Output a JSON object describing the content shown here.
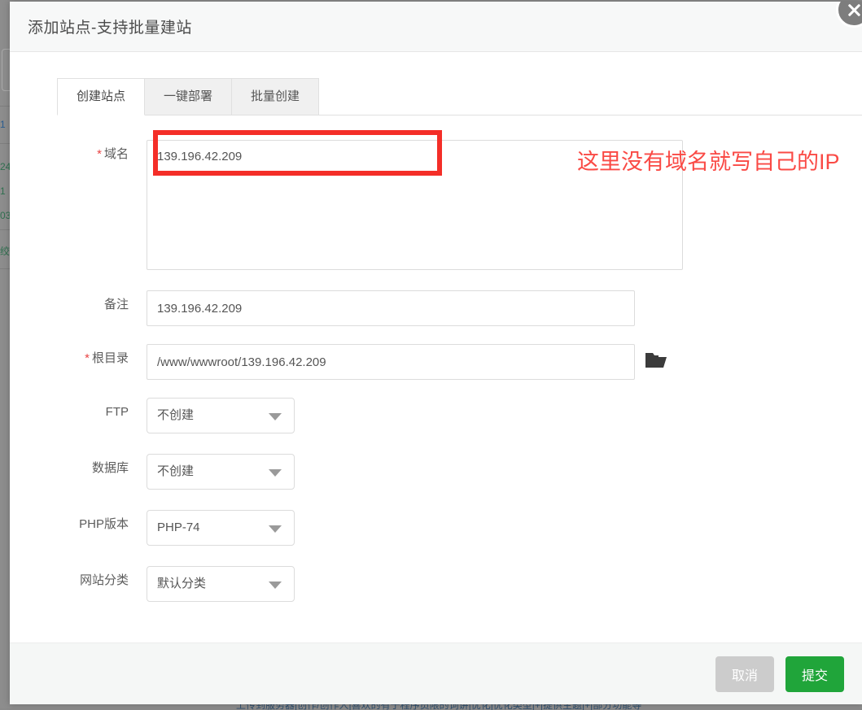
{
  "window": {
    "title": "添加站点-支持批量建站",
    "close_icon": "close-circle-icon"
  },
  "tabs": [
    {
      "label": "创建站点",
      "active": true
    },
    {
      "label": "一键部署",
      "active": false
    },
    {
      "label": "批量创建",
      "active": false
    }
  ],
  "form": {
    "domain": {
      "label": "域名",
      "required_mark": "*",
      "value": "139.196.42.209",
      "placeholder": ""
    },
    "remark": {
      "label": "备注",
      "value": "139.196.42.209",
      "placeholder": ""
    },
    "root_dir": {
      "label": "根目录",
      "required_mark": "*",
      "value": "/www/wwwroot/139.196.42.209",
      "placeholder": "",
      "browse_icon": "folder-open-icon"
    },
    "ftp": {
      "label": "FTP",
      "value": "不创建"
    },
    "database": {
      "label": "数据库",
      "value": "不创建"
    },
    "php_version": {
      "label": "PHP版本",
      "value": "PHP-74"
    },
    "site_category": {
      "label": "网站分类",
      "value": "默认分类"
    }
  },
  "annotations": {
    "highlight_box": {
      "target": "域名",
      "color": "#f42e28"
    },
    "note": "这里没有域名就写自己的IP",
    "note_color": "#fa4a45"
  },
  "footer": {
    "cancel_label": "取消",
    "submit_label": "提交",
    "cancel_color": "#cccccc",
    "submit_color": "#20a53a"
  },
  "background": {
    "left_fragments": [
      "1",
      "24",
      "1",
      "03",
      "绞"
    ],
    "bottom_fragment": "上传到服务器|创作/创作人|喜欢的有于程序员限的词讲|优化|优化类型|+|提供主题|+|部分功能等"
  }
}
